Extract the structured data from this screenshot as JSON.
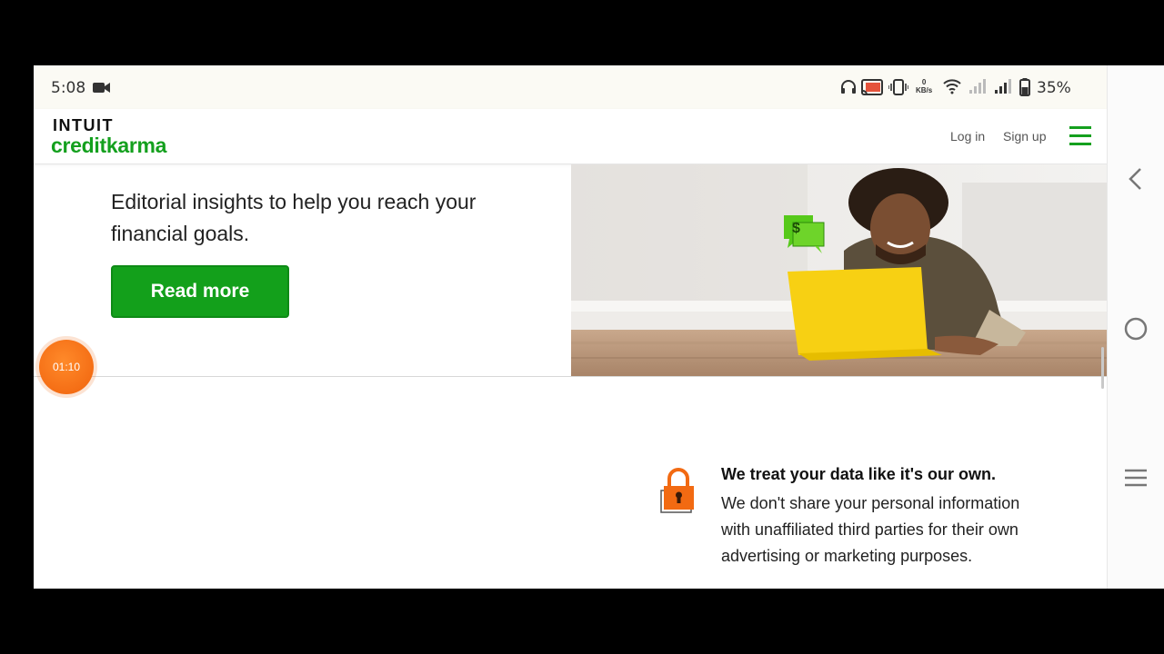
{
  "status_bar": {
    "time": "5:08",
    "kbs_value": "0",
    "kbs_unit": "KB/s",
    "battery_percent": "35%",
    "icons": [
      "video-camera-icon",
      "headphones-icon",
      "screen-cast-icon",
      "vibrate-icon",
      "wifi-icon",
      "signal-icon",
      "signal-icon",
      "battery-icon"
    ]
  },
  "header": {
    "logo_top": "INTUIT",
    "logo_bottom": "creditkarma",
    "login_label": "Log in",
    "signup_label": "Sign up",
    "menu_icon": "hamburger-menu-icon"
  },
  "hero": {
    "text": "Editorial insights to help you reach your financial goals.",
    "button_label": "Read more"
  },
  "recorder": {
    "timer": "01:10"
  },
  "data_section": {
    "title": "We treat your data like it's our own.",
    "body": "We don't share your personal information with unaffiliated third parties for their own advertising or marketing purposes."
  },
  "nav": {
    "back_icon": "back-chevron-icon",
    "home_icon": "home-circle-icon",
    "recents_icon": "recents-menu-icon"
  },
  "colors": {
    "brand_green": "#14a01e",
    "laptop_yellow": "#f7d013",
    "lock_orange": "#f26a12",
    "timer_orange": "#f0620c"
  }
}
